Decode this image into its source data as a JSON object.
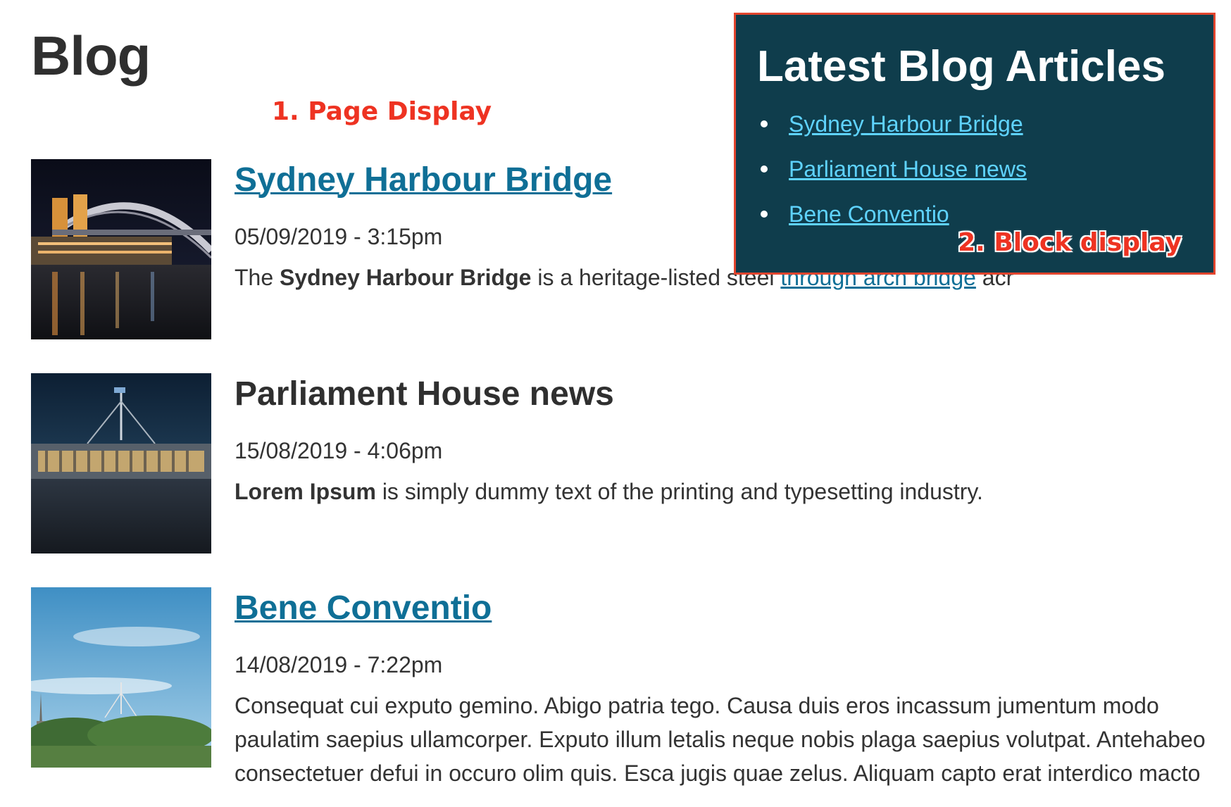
{
  "page": {
    "title": "Blog",
    "annotation_page": "1. Page Display",
    "annotation_block": "2. Block display"
  },
  "articles": [
    {
      "title": "Sydney Harbour Bridge",
      "title_linked": true,
      "date": "05/09/2019 - 3:15pm",
      "text_bold": "Sydney Harbour Bridge",
      "text_pre": "The ",
      "text_mid": " is a heritage-listed steel ",
      "text_link": "through arch bridge",
      "text_post": " acr",
      "image": "sydney-harbour-bridge-night-photo"
    },
    {
      "title": "Parliament House news",
      "title_linked": false,
      "date": "15/08/2019 - 4:06pm",
      "text_bold": "Lorem Ipsum",
      "text_post": " is simply dummy text of the printing and typesetting industry.",
      "image": "parliament-house-night-photo"
    },
    {
      "title": "Bene Conventio",
      "title_linked": true,
      "date": "14/08/2019 - 7:22pm",
      "text": "Consequat cui exputo gemino. Abigo patria tego. Causa duis eros incassum jumentum modo paulatim saepius ullamcorper. Exputo illum letalis neque nobis plaga saepius volutpat. Antehabeo consectetuer defui in occuro olim quis. Esca jugis quae zelus. Aliquam capto erat interdico macto",
      "image": "canberra-skyline-day-photo"
    }
  ],
  "block": {
    "title": "Latest Blog Articles",
    "items": [
      "Sydney Harbour Bridge",
      "Parliament House news",
      "Bene Conventio"
    ]
  },
  "colors": {
    "link": "#0f6f96",
    "block_bg": "#0f3d4c",
    "block_link": "#5fd3ff",
    "annotation": "#ee3322"
  }
}
